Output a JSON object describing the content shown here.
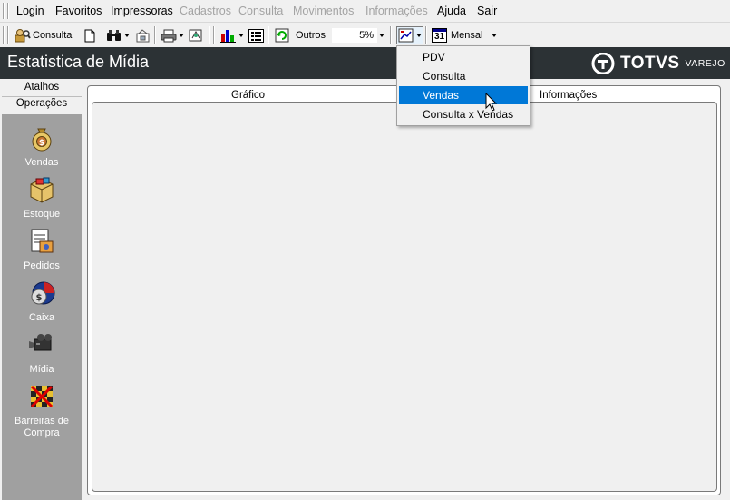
{
  "menubar": {
    "items": [
      {
        "label": "Login",
        "enabled": true
      },
      {
        "label": "Favoritos",
        "enabled": true
      },
      {
        "label": "Impressoras",
        "enabled": true
      },
      {
        "label": "Cadastros",
        "enabled": false
      },
      {
        "label": "Consulta",
        "enabled": false
      },
      {
        "label": "Movimentos",
        "enabled": false
      },
      {
        "label": "Informações",
        "enabled": false
      },
      {
        "label": "Ajuda",
        "enabled": true
      },
      {
        "label": "Sair",
        "enabled": true
      }
    ]
  },
  "toolbar": {
    "consulta_label": "Consulta",
    "outros_label": "Outros",
    "percent_value": "5%",
    "period_label": "Mensal",
    "calendar_day": "31"
  },
  "titlebar": {
    "title": "Estatistica de Mídia",
    "logo_text": "TOTVS",
    "logo_sub": "VAREJO"
  },
  "leftpanel": {
    "tabs": [
      "Atalhos",
      "Operações"
    ],
    "items": [
      {
        "label": "Vendas",
        "icon": "money-bag-icon"
      },
      {
        "label": "Estoque",
        "icon": "box-icon"
      },
      {
        "label": "Pedidos",
        "icon": "order-icon"
      },
      {
        "label": "Caixa",
        "icon": "cash-register-icon"
      },
      {
        "label": "Mídia",
        "icon": "camera-icon"
      },
      {
        "label": "Barreiras de Compra",
        "icon": "barrier-icon"
      }
    ]
  },
  "main": {
    "tabs": [
      "Gráfico",
      "Informações"
    ]
  },
  "dropdown": {
    "items": [
      "PDV",
      "Consulta",
      "Vendas",
      "Consulta x Vendas"
    ],
    "selected": "Vendas"
  },
  "colors": {
    "titlebar_bg": "#2c3235",
    "leftpanel_bg": "#a0a0a0",
    "selection": "#0078d7"
  }
}
